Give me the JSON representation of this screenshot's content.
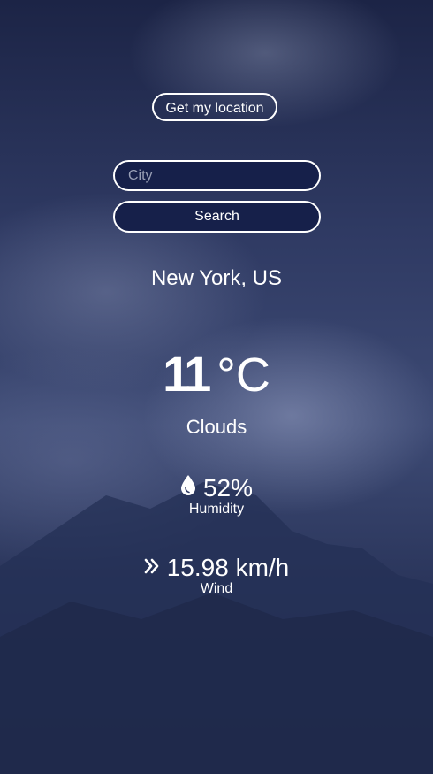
{
  "location_button": {
    "label": "Get my location"
  },
  "search": {
    "placeholder": "City",
    "value": "",
    "button_label": "Search"
  },
  "weather": {
    "place": "New York, US",
    "temperature": "11",
    "unit": "°C",
    "description": "Clouds",
    "humidity": {
      "value": "52%",
      "label": "Humidity",
      "icon": "water-drop-icon"
    },
    "wind": {
      "value": "15.98 km/h",
      "label": "Wind",
      "icon": "double-chevron-right-icon"
    }
  },
  "colors": {
    "background": "#2a3558",
    "button_fill": "#16204a",
    "text": "#ffffff"
  }
}
